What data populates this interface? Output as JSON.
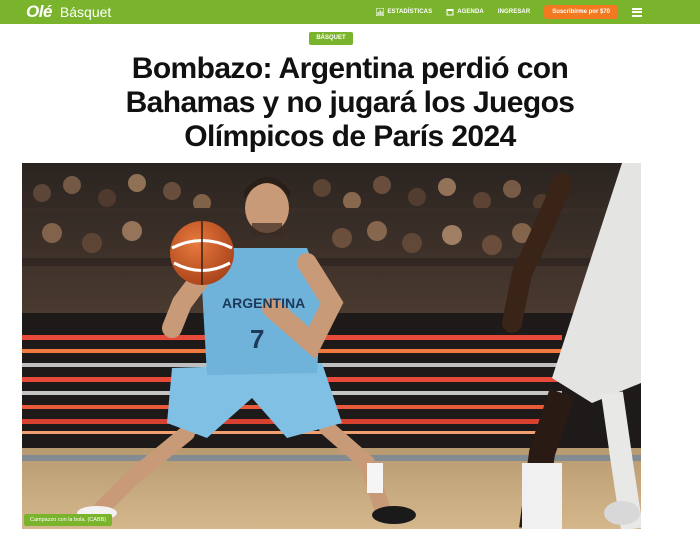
{
  "header": {
    "logo": "Olé",
    "section": "Básquet",
    "nav": [
      {
        "label": "ESTADÍSTICAS",
        "icon": "chart-icon"
      },
      {
        "label": "AGENDA",
        "icon": "calendar-icon"
      },
      {
        "label": "INGRESAR"
      }
    ],
    "subscribe_label": "Suscribirme por $70",
    "menu_icon": "hamburger-menu-icon"
  },
  "article": {
    "category": "BÁSQUET",
    "headline_line1": "Bombazo: Argentina perdió con",
    "headline_line2": "Bahamas y no jugará los Juegos",
    "headline_line3": "Olímpicos de París 2024",
    "photo": {
      "jersey_text": "ARGENTINA",
      "jersey_number": "7",
      "caption": "Campazzo con la bola. (CABB)"
    }
  },
  "colors": {
    "brand_green": "#7ab42c",
    "subscribe_orange": "#f47a22",
    "jersey_blue": "#6fb3da"
  }
}
